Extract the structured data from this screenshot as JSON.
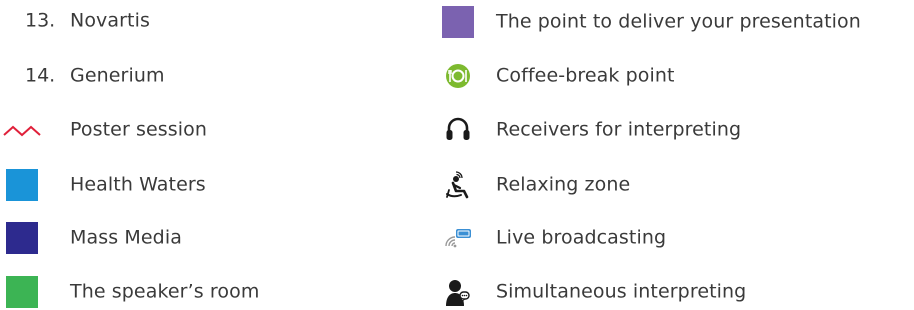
{
  "left": {
    "items": [
      {
        "number": "13.",
        "label": "Novartis"
      },
      {
        "number": "14.",
        "label": "Generium"
      },
      {
        "label": "Poster session",
        "icon": "zigzag-line-icon",
        "color": "#e0203a"
      },
      {
        "label": "Health Waters",
        "icon": "color-square",
        "color": "#1a94d8"
      },
      {
        "label": "Mass Media",
        "icon": "color-square",
        "color": "#2d2a8e"
      },
      {
        "label": "The speaker’s room",
        "icon": "color-square",
        "color": "#3cb454"
      }
    ]
  },
  "right": {
    "items": [
      {
        "label": "The point to deliver your presentation",
        "icon": "color-square",
        "color": "#7b62b0"
      },
      {
        "label": "Coffee-break point",
        "icon": "coffee-break-icon",
        "color": "#7dba2f"
      },
      {
        "label": "Receivers for interpreting",
        "icon": "headphones-icon",
        "color": "#1a1a1a"
      },
      {
        "label": "Relaxing zone",
        "icon": "relaxing-person-icon",
        "color": "#1a1a1a"
      },
      {
        "label": "Live broadcasting",
        "icon": "live-broadcast-icon",
        "color": "#3a8fd4"
      },
      {
        "label": "Simultaneous interpreting",
        "icon": "interpreter-person-icon",
        "color": "#1a1a1a"
      }
    ]
  }
}
